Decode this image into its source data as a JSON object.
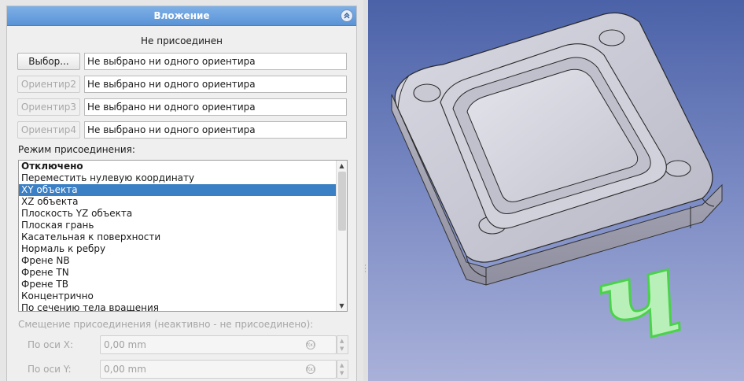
{
  "panel": {
    "title": "Вложение",
    "status": "Не присоединен"
  },
  "references": [
    {
      "button": "Выбор...",
      "value": "Не выбрано ни одного ориентира"
    },
    {
      "button": "Ориентир2",
      "value": "Не выбрано ни одного ориентира"
    },
    {
      "button": "Ориентир3",
      "value": "Не выбрано ни одного ориентира"
    },
    {
      "button": "Ориентир4",
      "value": "Не выбрано ни одного ориентира"
    }
  ],
  "mode": {
    "label": "Режим присоединения:",
    "items": [
      "Отключено",
      "Переместить нулевую координату",
      "XY объекта",
      "XZ объекта",
      "Плоскость YZ объекта",
      "Плоская грань",
      "Касательная к поверхности",
      "Нормаль к ребру",
      "Френе NB",
      "Френе TN",
      "Френе TB",
      "Концентрично",
      "По сечению тела вращения"
    ],
    "selected": "XY объекта"
  },
  "offset": {
    "label": "Смещение присоединения (неактивно - не присоединено):",
    "x_label": "По оси X:",
    "x_value": "0,00 mm",
    "y_label": "По оси Y:",
    "y_value": "0,00 mm"
  },
  "viewport": {
    "text_glyph": "ч"
  },
  "colors": {
    "header": "#5a93d6",
    "selection": "#3b7fc4",
    "viewport_top": "#4b62a8",
    "viewport_bottom": "#a9b1d9",
    "model": "#c7c7d2",
    "glyph_fill": "#b9f0b9",
    "glyph_outline": "#4ad24a"
  }
}
